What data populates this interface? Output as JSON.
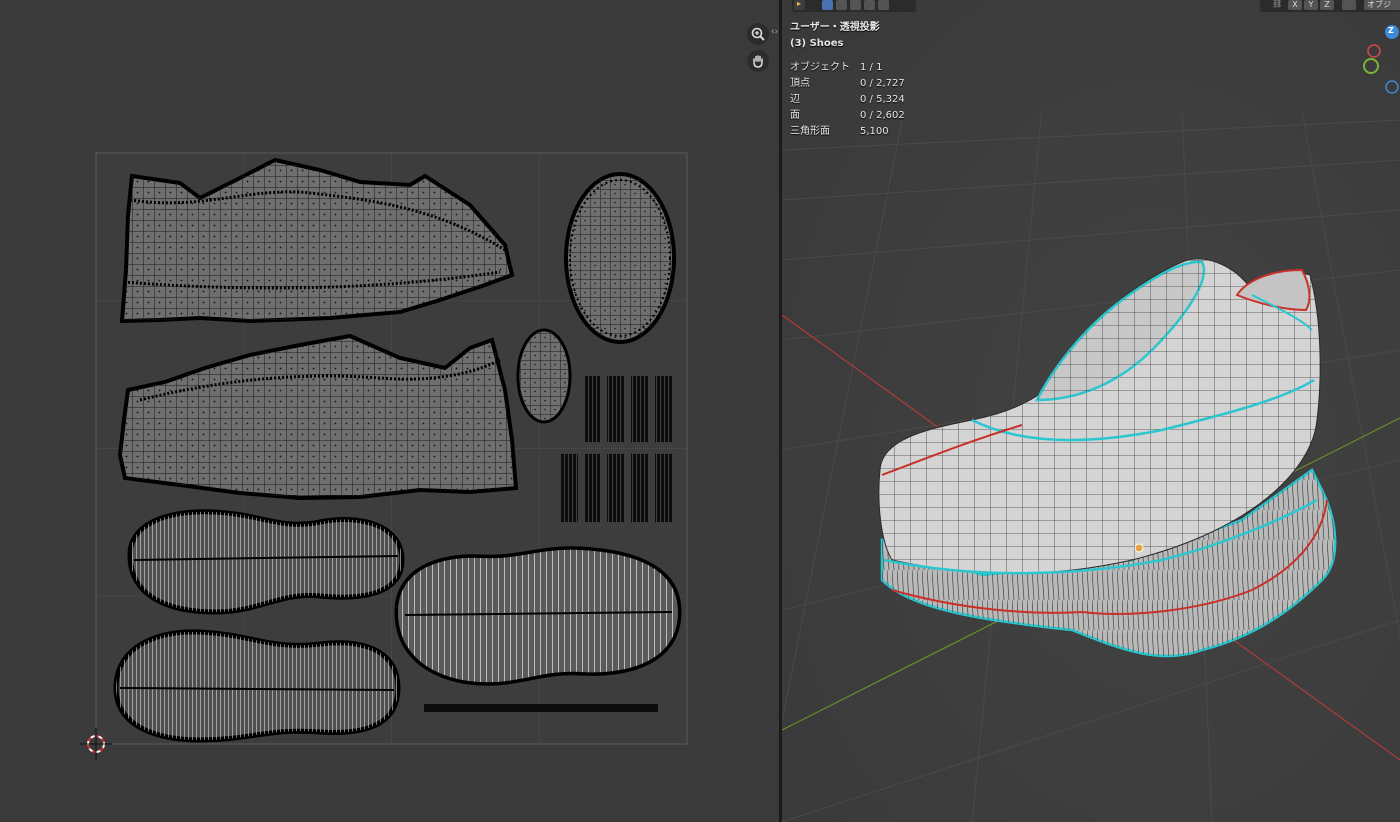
{
  "uv_editor": {
    "nav": {
      "zoom_icon": "zoom-in-icon",
      "pan_icon": "hand-icon"
    },
    "split_arrows": "‹›"
  },
  "viewport": {
    "view_name": "ユーザー・透視投影",
    "collection": "(3) Shoes",
    "stats": [
      {
        "label": "オブジェクト",
        "value": "1 / 1"
      },
      {
        "label": "頂点",
        "value": "0 / 2,727"
      },
      {
        "label": "辺",
        "value": "0 / 5,324"
      },
      {
        "label": "面",
        "value": "0 / 2,602"
      },
      {
        "label": "三角形面",
        "value": "5,100"
      }
    ],
    "header": {
      "axis_x": "X",
      "axis_y": "Y",
      "axis_z": "Z",
      "mode_partial": "オブジ"
    },
    "gizmo_z_label": "Z",
    "colors": {
      "seam": "#c8302a",
      "selected_edge": "#35d8e0",
      "x_axis": "#b23a3a",
      "y_axis": "#6a8f2a"
    }
  }
}
